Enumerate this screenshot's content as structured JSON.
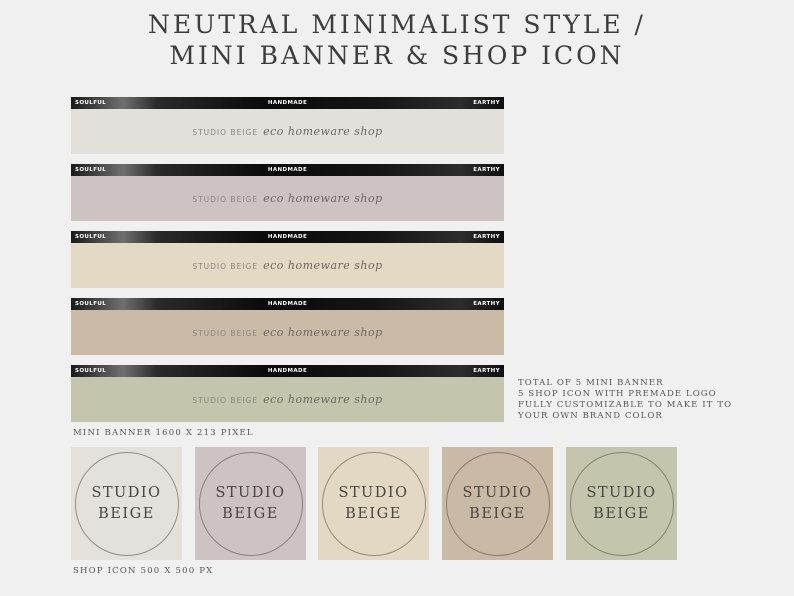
{
  "header": {
    "title_line1": "NEUTRAL MINIMALIST STYLE /",
    "title_line2": "MINI BANNER & SHOP ICON"
  },
  "banner_strip": {
    "left": "SOULFUL",
    "center": "HANDMADE",
    "right": "EARTHY"
  },
  "banner_text": {
    "studio": "STUDIO BEIGE",
    "script": "eco homeware shop"
  },
  "banners": [
    {
      "color": "#e1e0db"
    },
    {
      "color": "#cdc3c2"
    },
    {
      "color": "#e3d9c5"
    },
    {
      "color": "#c9bba6"
    },
    {
      "color": "#c3c5ad"
    }
  ],
  "captions": {
    "banner": "MINI BANNER 1600 X 213 PIXEL",
    "icon": "SHOP ICON 500 X 500 PX"
  },
  "info_lines": [
    "TOTAL OF 5 MINI BANNER",
    "5 SHOP ICON WITH PREMADE LOGO",
    "FULLY CUSTOMIZABLE TO MAKE IT TO",
    "YOUR OWN BRAND COLOR"
  ],
  "icon_logo": {
    "line1": "STUDIO",
    "line2": "BEIGE"
  },
  "icons": [
    {
      "color": "#e2e1dc"
    },
    {
      "color": "#cdc3c2"
    },
    {
      "color": "#e3d8c4"
    },
    {
      "color": "#c8baa5"
    },
    {
      "color": "#c3c5ad"
    }
  ]
}
